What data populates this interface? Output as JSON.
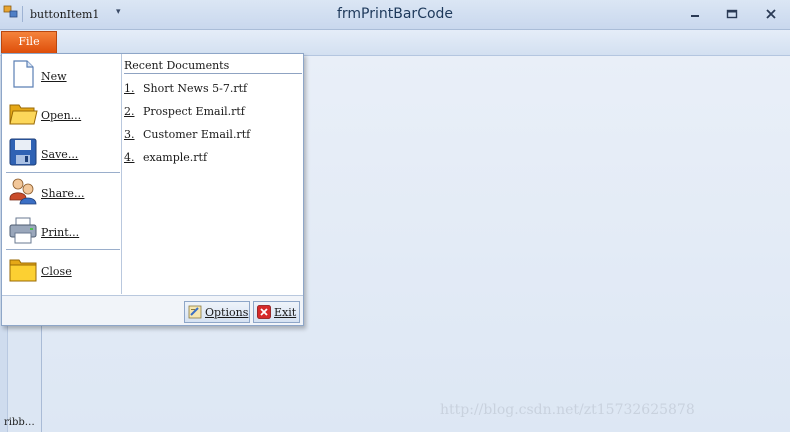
{
  "window": {
    "title": "frmPrintBarCode",
    "minimize_glyph": "▭",
    "maximize_glyph": "▢",
    "close_glyph": "✕"
  },
  "quick_access": {
    "item_label": "buttonItem1",
    "dropdown_glyph": "▾"
  },
  "file_tab": {
    "label": "File",
    "color": "#e8621c"
  },
  "file_menu": {
    "items": [
      {
        "label": "New",
        "icon": "new-document-icon"
      },
      {
        "label": "Open...",
        "icon": "open-folder-icon"
      },
      {
        "label": "Save...",
        "icon": "save-disk-icon"
      },
      {
        "label": "Share...",
        "icon": "users-share-icon"
      },
      {
        "label": "Print...",
        "icon": "printer-icon"
      },
      {
        "label": "Close",
        "icon": "close-folder-icon"
      }
    ],
    "recent": {
      "title": "Recent Documents",
      "items": [
        {
          "num": "1.",
          "name": "Short News 5-7.rtf"
        },
        {
          "num": "2.",
          "name": "Prospect Email.rtf"
        },
        {
          "num": "3.",
          "name": "Customer Email.rtf"
        },
        {
          "num": "4.",
          "name": "example.rtf"
        }
      ]
    },
    "footer": {
      "options_label": "Options",
      "exit_label": "Exit"
    }
  },
  "ribbon_bar_label": "ribb…",
  "watermark": "http://blog.csdn.net/zt15732625878"
}
